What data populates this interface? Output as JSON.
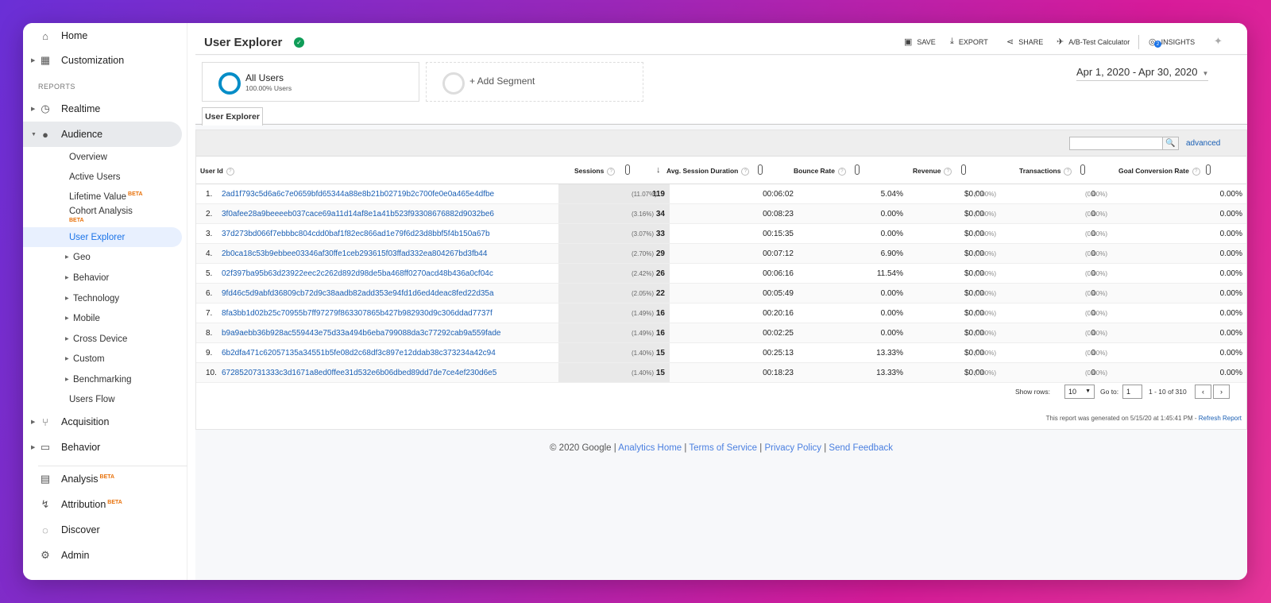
{
  "sidebar": {
    "home": "Home",
    "customization": "Customization",
    "reports_label": "REPORTS",
    "realtime": "Realtime",
    "audience": "Audience",
    "audience_items": {
      "overview": "Overview",
      "active_users": "Active Users",
      "lifetime_value": "Lifetime Value",
      "cohort_analysis": "Cohort Analysis",
      "user_explorer": "User Explorer",
      "geo": "Geo",
      "behavior": "Behavior",
      "technology": "Technology",
      "mobile": "Mobile",
      "cross_device": "Cross Device",
      "custom": "Custom",
      "benchmarking": "Benchmarking",
      "users_flow": "Users Flow"
    },
    "acquisition": "Acquisition",
    "behavior": "Behavior",
    "analysis": "Analysis",
    "attribution": "Attribution",
    "discover": "Discover",
    "admin": "Admin",
    "beta": "BETA"
  },
  "header": {
    "title": "User Explorer",
    "save": "SAVE",
    "export": "EXPORT",
    "share": "SHARE",
    "ab_test": "A/B-Test Calculator",
    "insights": "INSIGHTS",
    "insights_badge": "2"
  },
  "segments": {
    "all_users": "All Users",
    "all_users_sub": "100.00% Users",
    "add_segment": "+ Add Segment"
  },
  "date_range": "Apr 1, 2020 - Apr 30, 2020",
  "tab": "User Explorer",
  "filter": {
    "advanced": "advanced"
  },
  "table": {
    "headers": {
      "user_id": "User Id",
      "sessions": "Sessions",
      "avg_duration": "Avg. Session Duration",
      "bounce_rate": "Bounce Rate",
      "revenue": "Revenue",
      "transactions": "Transactions",
      "goal_conversion": "Goal Conversion Rate"
    },
    "rows": [
      {
        "idx": "1.",
        "uid": "2ad1f793c5d6a6c7e0659bfd65344a88e8b21b02719b2c700fe0e0a465e4dfbe",
        "sessions": "119",
        "sessions_pct": "(11.07%)",
        "duration": "00:06:02",
        "bounce": "5.04%",
        "revenue": "$0.00",
        "revenue_pct": "(0.00%)",
        "trans": "0",
        "trans_pct": "(0.00%)",
        "goal": "0.00%"
      },
      {
        "idx": "2.",
        "uid": "3f0afee28a9beeeeb037cace69a11d14af8e1a41b523f93308676882d9032be6",
        "sessions": "34",
        "sessions_pct": "(3.16%)",
        "duration": "00:08:23",
        "bounce": "0.00%",
        "revenue": "$0.00",
        "revenue_pct": "(0.00%)",
        "trans": "0",
        "trans_pct": "(0.00%)",
        "goal": "0.00%"
      },
      {
        "idx": "3.",
        "uid": "37d273bd066f7ebbbc804cdd0baf1f82ec866ad1e79f6d23d8bbf5f4b150a67b",
        "sessions": "33",
        "sessions_pct": "(3.07%)",
        "duration": "00:15:35",
        "bounce": "0.00%",
        "revenue": "$0.00",
        "revenue_pct": "(0.00%)",
        "trans": "0",
        "trans_pct": "(0.00%)",
        "goal": "0.00%"
      },
      {
        "idx": "4.",
        "uid": "2b0ca18c53b9ebbee03346af30ffe1ceb293615f03ffad332ea804267bd3fb44",
        "sessions": "29",
        "sessions_pct": "(2.70%)",
        "duration": "00:07:12",
        "bounce": "6.90%",
        "revenue": "$0.00",
        "revenue_pct": "(0.00%)",
        "trans": "0",
        "trans_pct": "(0.00%)",
        "goal": "0.00%"
      },
      {
        "idx": "5.",
        "uid": "02f397ba95b63d23922eec2c262d892d98de5ba468ff0270acd48b436a0cf04c",
        "sessions": "26",
        "sessions_pct": "(2.42%)",
        "duration": "00:06:16",
        "bounce": "11.54%",
        "revenue": "$0.00",
        "revenue_pct": "(0.00%)",
        "trans": "0",
        "trans_pct": "(0.00%)",
        "goal": "0.00%"
      },
      {
        "idx": "6.",
        "uid": "9fd46c5d9abfd36809cb72d9c38aadb82add353e94fd1d6ed4deac8fed22d35a",
        "sessions": "22",
        "sessions_pct": "(2.05%)",
        "duration": "00:05:49",
        "bounce": "0.00%",
        "revenue": "$0.00",
        "revenue_pct": "(0.00%)",
        "trans": "0",
        "trans_pct": "(0.00%)",
        "goal": "0.00%"
      },
      {
        "idx": "7.",
        "uid": "8fa3bb1d02b25c70955b7ff97279f863307865b427b982930d9c306ddad7737f",
        "sessions": "16",
        "sessions_pct": "(1.49%)",
        "duration": "00:20:16",
        "bounce": "0.00%",
        "revenue": "$0.00",
        "revenue_pct": "(0.00%)",
        "trans": "0",
        "trans_pct": "(0.00%)",
        "goal": "0.00%"
      },
      {
        "idx": "8.",
        "uid": "b9a9aebb36b928ac559443e75d33a494b6eba799088da3c77292cab9a559fade",
        "sessions": "16",
        "sessions_pct": "(1.49%)",
        "duration": "00:02:25",
        "bounce": "0.00%",
        "revenue": "$0.00",
        "revenue_pct": "(0.00%)",
        "trans": "0",
        "trans_pct": "(0.00%)",
        "goal": "0.00%"
      },
      {
        "idx": "9.",
        "uid": "6b2dfa471c62057135a34551b5fe08d2c68df3c897e12ddab38c373234a42c94",
        "sessions": "15",
        "sessions_pct": "(1.40%)",
        "duration": "00:25:13",
        "bounce": "13.33%",
        "revenue": "$0.00",
        "revenue_pct": "(0.00%)",
        "trans": "0",
        "trans_pct": "(0.00%)",
        "goal": "0.00%"
      },
      {
        "idx": "10.",
        "uid": "6728520731333c3d1671a8ed0ffee31d532e6b06dbed89dd7de7ce4ef230d6e5",
        "sessions": "15",
        "sessions_pct": "(1.40%)",
        "duration": "00:18:23",
        "bounce": "13.33%",
        "revenue": "$0.00",
        "revenue_pct": "(0.00%)",
        "trans": "0",
        "trans_pct": "(0.00%)",
        "goal": "0.00%"
      }
    ]
  },
  "pager": {
    "show_rows_label": "Show rows:",
    "show_rows_value": "10",
    "goto_label": "Go to:",
    "goto_value": "1",
    "range": "1 - 10 of 310",
    "prev": "‹",
    "next": "›"
  },
  "generated": {
    "text": "This report was generated on 5/15/20 at 1:45:41 PM - ",
    "refresh": "Refresh Report"
  },
  "footer": {
    "copyright": "© 2020 Google |",
    "analytics_home": "Analytics Home",
    "terms": "Terms of Service",
    "privacy": "Privacy Policy",
    "feedback": "Send Feedback",
    "sep": "|"
  },
  "colors": {
    "accent_blue": "#1a73e8",
    "link_blue": "#1a5fb4",
    "beta_orange": "#e8710a",
    "verified_green": "#0f9d58"
  }
}
